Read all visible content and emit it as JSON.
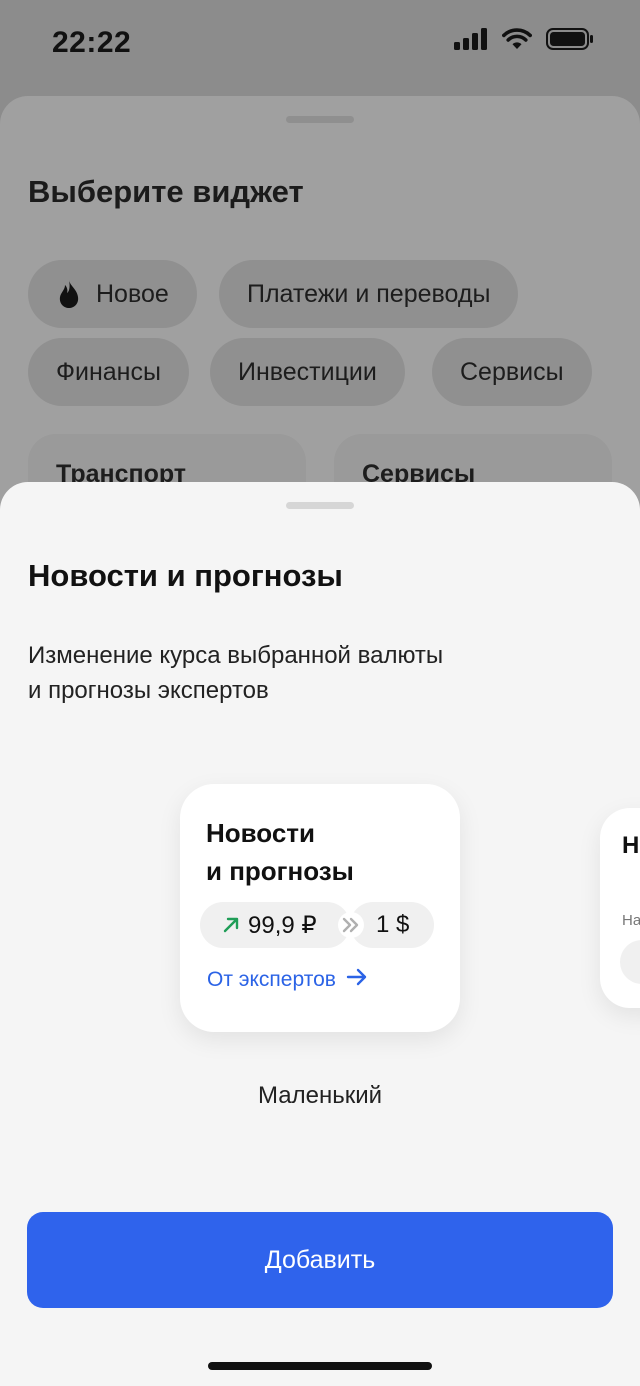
{
  "status_bar": {
    "time": "22:22"
  },
  "background_sheet": {
    "title": "Выберите виджет",
    "chips": [
      "Новое",
      "Платежи и переводы",
      "Финансы",
      "Инвестиции",
      "Сервисы"
    ],
    "cards": [
      "Транспорт",
      "Сервисы"
    ]
  },
  "sheet": {
    "title": "Новости и прогнозы",
    "description_line1": "Изменение курса выбранной валюты",
    "description_line2": "и прогнозы экспертов",
    "widget": {
      "title_line1": "Новости",
      "title_line2": "и прогнозы",
      "rate_value": "99,9 ₽",
      "rate_target": "1 $",
      "experts_link": "От экспертов"
    },
    "peek_card": {
      "title": "Н",
      "subtitle": "На"
    },
    "size_label": "Маленький",
    "add_button": "Добавить"
  },
  "colors": {
    "accent": "#2f63ec",
    "rate_up": "#1f9d57"
  }
}
